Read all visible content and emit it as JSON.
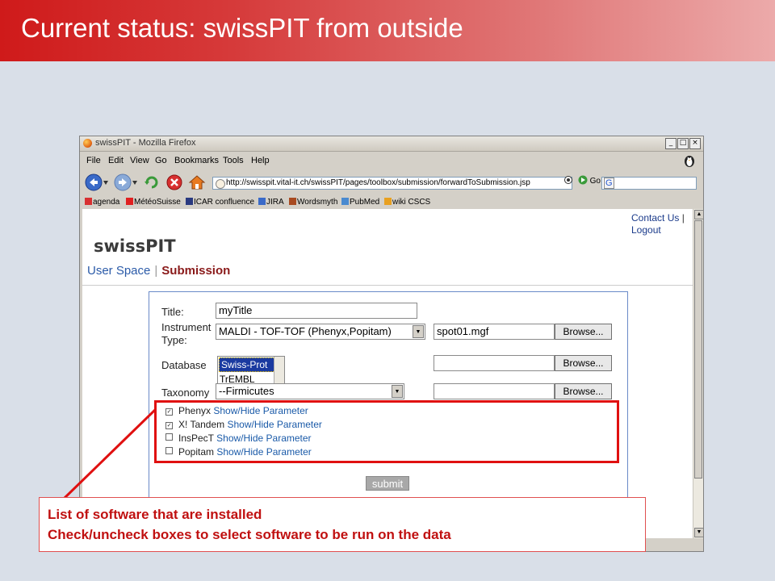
{
  "slide": {
    "title": "Current status: swissPIT from outside"
  },
  "browser": {
    "window_title": "swissPIT - Mozilla Firefox",
    "menu": [
      "File",
      "Edit",
      "View",
      "Go",
      "Bookmarks",
      "Tools",
      "Help"
    ],
    "url": "http://swisspit.vital-it.ch/swissPIT/pages/toolbox/submission/forwardToSubmission.jsp",
    "go_label": "Go",
    "search_engine": "G",
    "bookmarks": [
      "agenda",
      "MétéoSuisse",
      "ICAR confluence",
      "JIRA",
      "Wordsmyth",
      "PubMed",
      "wiki CSCS"
    ]
  },
  "page": {
    "top_links": {
      "contact": "Contact Us",
      "separator": "|",
      "logout": "Logout"
    },
    "brand": "swissPIT",
    "tabs": {
      "user_space": "User Space",
      "separator": "|",
      "submission": "Submission"
    }
  },
  "form": {
    "title_label": "Title:",
    "title_value": "myTitle",
    "instrument_label_1": "Instrument",
    "instrument_label_2": "Type:",
    "instrument_value": "MALDI - TOF-TOF (Phenyx,Popitam)",
    "file_1": "spot01.mgf",
    "browse_label": "Browse...",
    "database_label": "Database",
    "database_options": [
      "Swiss-Prot",
      "TrEMBL"
    ],
    "database_selected": "Swiss-Prot",
    "taxonomy_label": "Taxonomy",
    "taxonomy_value": "--Firmicutes",
    "software": [
      {
        "name": "Phenyx",
        "checked": true,
        "link": "Show/Hide Parameter"
      },
      {
        "name": "X! Tandem",
        "checked": true,
        "link": "Show/Hide Parameter"
      },
      {
        "name": "InsPecT",
        "checked": false,
        "link": "Show/Hide Parameter"
      },
      {
        "name": "Popitam",
        "checked": false,
        "link": "Show/Hide Parameter"
      }
    ],
    "submit_label": "submit"
  },
  "callout": {
    "line_1": "List of software that are installed",
    "line_2": "Check/uncheck boxes to select software to be run on the data"
  },
  "colors": {
    "header_red": "#cf1a1a",
    "highlight": "#e01010",
    "callout_text": "#c01010",
    "link_blue": "#1a5aa8"
  }
}
